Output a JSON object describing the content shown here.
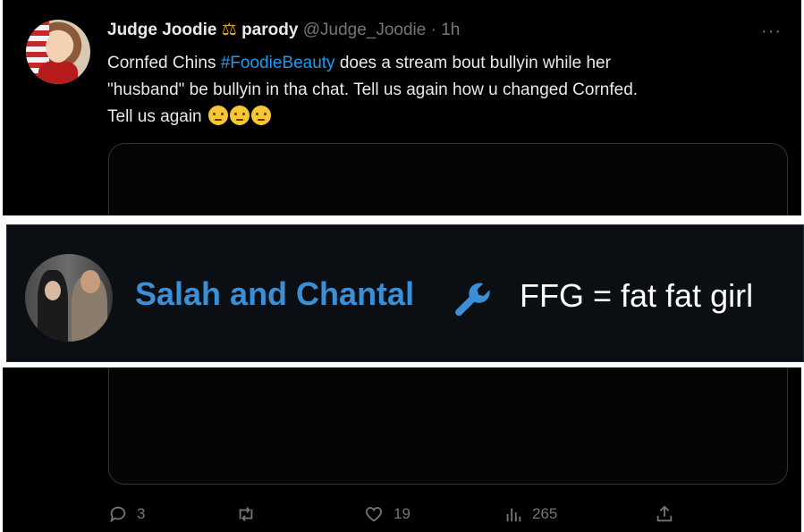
{
  "tweet": {
    "display_name": "Judge Joodie",
    "badge_emoji": "⚖",
    "label": "parody",
    "handle": "@Judge_Joodie",
    "separator": "·",
    "time": "1h",
    "more": "···",
    "text_line1_before": "Cornfed Chins ",
    "hashtag": "#FoodieBeauty",
    "text_line1_after": " does a stream bout bullyin while her",
    "text_line2": "\"husband\" be bullyin in tha chat. Tell us again how u changed Cornfed.",
    "text_line3": "Tell us again"
  },
  "chat_banner": {
    "username": "Salah and Chantal",
    "message": "FFG = fat fat girl"
  },
  "actions": {
    "replies": "3",
    "retweets": "",
    "likes": "19",
    "views": "265"
  },
  "colors": {
    "accent": "#1d9bf0",
    "muted": "#71767b",
    "chat_name": "#3b8fd6"
  }
}
